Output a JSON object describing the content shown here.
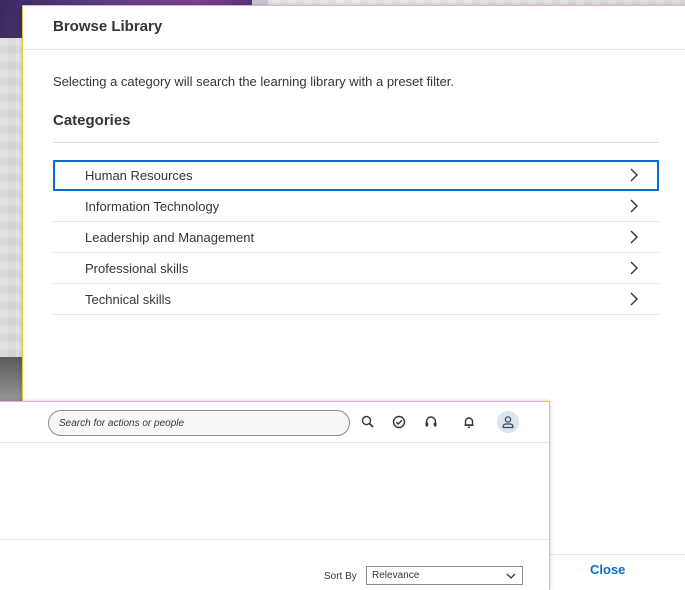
{
  "dialog": {
    "title": "Browse Library",
    "description": "Selecting a category will search the learning library with a preset filter.",
    "categories_heading": "Categories",
    "categories": [
      {
        "label": "Human Resources",
        "selected": true
      },
      {
        "label": "Information Technology",
        "selected": false
      },
      {
        "label": "Leadership and Management",
        "selected": false
      },
      {
        "label": "Professional skills",
        "selected": false
      },
      {
        "label": "Technical skills",
        "selected": false
      }
    ],
    "close_label": "Close"
  },
  "shell": {
    "search": {
      "placeholder": "Search for actions or people"
    },
    "toolbar_icons": [
      "search-icon",
      "approvals-check-icon",
      "headset-support-icon",
      "notification-bell-icon",
      "user-avatar-icon"
    ],
    "sort": {
      "label": "Sort By",
      "selected": "Relevance"
    }
  },
  "colors": {
    "accent": "#0a6ed1",
    "window_focus_border": "#e8c84a",
    "text": "#32363a",
    "banner": "#5a3f86"
  }
}
